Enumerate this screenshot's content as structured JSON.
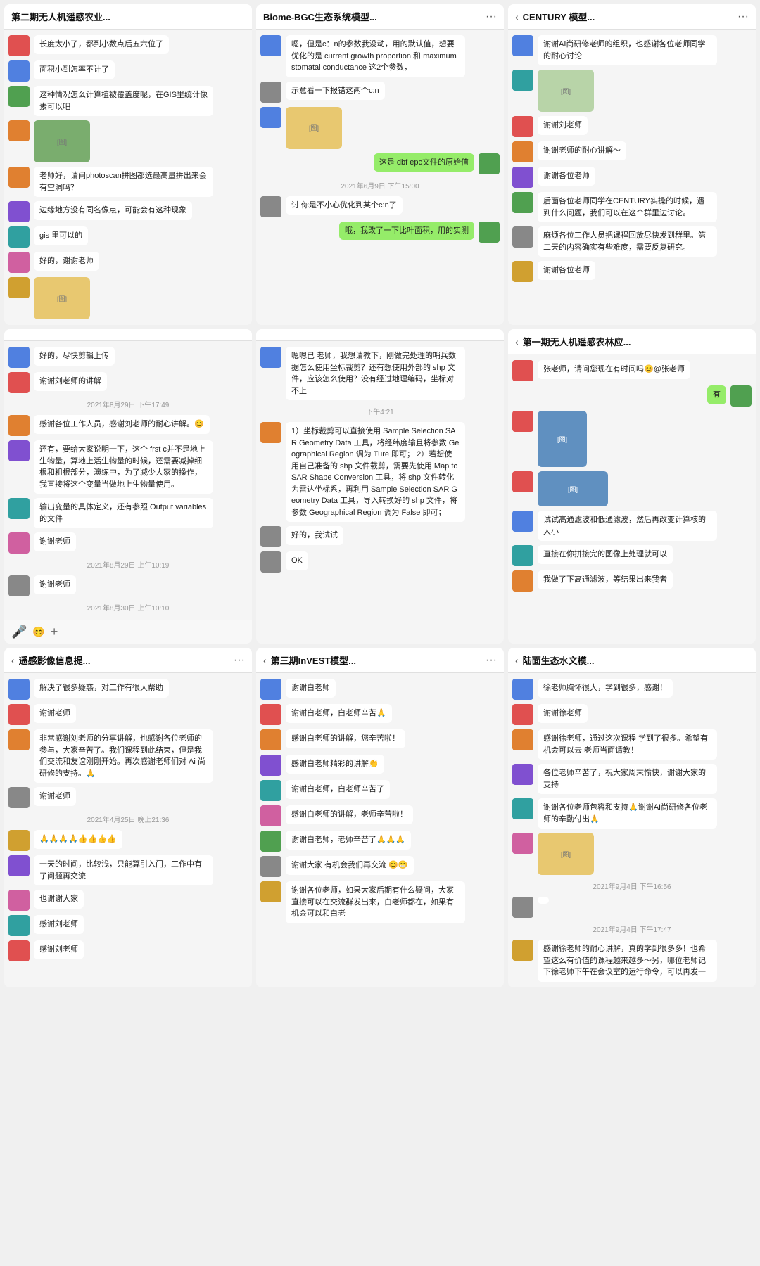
{
  "panels": [
    {
      "id": "panel-1",
      "hasBack": false,
      "title": "第二期无人机遥感农业...",
      "hasMore": false,
      "messages": [
        {
          "type": "msg",
          "side": "left",
          "avatarColor": "red",
          "text": "长度太小了，都到小数点后五六位了"
        },
        {
          "type": "msg",
          "side": "left",
          "avatarColor": "blue",
          "text": "面积小到怎率不计了"
        },
        {
          "type": "msg",
          "side": "left",
          "avatarColor": "green",
          "text": "这种情况怎么计算植被覆盖度呢，在GIS里统计像素可以吧"
        },
        {
          "type": "img",
          "side": "left",
          "avatarColor": "orange",
          "imgClass": "green-img"
        },
        {
          "type": "msg",
          "side": "left",
          "avatarColor": "orange",
          "text": "老师好，请问photoscan拼图都选最高量拼出来会有空洞吗？"
        },
        {
          "type": "msg",
          "side": "left",
          "avatarColor": "purple",
          "text": "边缘地方没有同名像点，可能会有这种现象"
        },
        {
          "type": "msg",
          "side": "left",
          "avatarColor": "teal",
          "text": "gis 里可以的"
        },
        {
          "type": "msg",
          "side": "left",
          "avatarColor": "pink",
          "text": "好的，谢谢老师"
        },
        {
          "type": "img",
          "side": "left",
          "avatarColor": "yellow",
          "imgClass": ""
        }
      ],
      "hasFooter": false
    },
    {
      "id": "panel-2",
      "hasBack": false,
      "title": "Biome-BGC生态系统模型...",
      "hasMore": true,
      "messages": [
        {
          "type": "msg",
          "side": "left",
          "avatarColor": "blue",
          "text": "嗯，但是c：n的参数我没动，用的默认值，想要优化的是 current growth proportion 和 maximum stomatal conductance 这2个参数，"
        },
        {
          "type": "msg",
          "side": "left",
          "avatarColor": "gray",
          "text": "示意看一下报错这两个c:n"
        },
        {
          "type": "img",
          "side": "left",
          "avatarColor": "blue",
          "imgClass": "doc-img"
        },
        {
          "type": "msg",
          "side": "right",
          "avatarColor": "green",
          "text": "这是 dbf epc文件的原始值"
        },
        {
          "type": "timestamp",
          "text": "2021年6月9日 下午15:00"
        },
        {
          "type": "msg",
          "side": "left",
          "avatarColor": "gray",
          "text": "讨 你是不小心优化到某个c:n了"
        },
        {
          "type": "msg",
          "side": "right",
          "avatarColor": "green",
          "text": "哦，我改了一下比叶面积，用的实测"
        }
      ],
      "hasFooter": false
    },
    {
      "id": "panel-3",
      "hasBack": true,
      "title": "CENTURY 模型...",
      "hasMore": true,
      "messages": [
        {
          "type": "msg",
          "side": "left",
          "avatarColor": "blue",
          "text": "谢谢AI尚研修老师的组织，也感谢各位老师同学的耐心讨论"
        },
        {
          "type": "img",
          "side": "left",
          "avatarColor": "teal",
          "imgClass": "map-img"
        },
        {
          "type": "msg",
          "side": "left",
          "avatarColor": "red",
          "text": "谢谢刘老师"
        },
        {
          "type": "msg",
          "side": "left",
          "avatarColor": "orange",
          "text": "谢谢老师的耐心讲解～"
        },
        {
          "type": "msg",
          "side": "left",
          "avatarColor": "purple",
          "text": "谢谢各位老师"
        },
        {
          "type": "msg",
          "side": "left",
          "avatarColor": "green",
          "text": "后面各位老师同学在CENTURY实操的时候，遇到什么问题，我们可以在这个群里边讨论。"
        },
        {
          "type": "msg",
          "side": "left",
          "avatarColor": "gray",
          "text": "麻烦各位工作人员把课程回放尽快发到群里。第二天的内容确实有些难度，需要反复研究。"
        },
        {
          "type": "msg",
          "side": "left",
          "avatarColor": "yellow",
          "text": "谢谢各位老师"
        }
      ],
      "hasFooter": false
    },
    {
      "id": "panel-4",
      "hasBack": false,
      "title": "",
      "hasMore": false,
      "messages": [
        {
          "type": "msg",
          "side": "left",
          "avatarColor": "blue",
          "text": "好的，尽快剪辑上传"
        },
        {
          "type": "msg",
          "side": "left",
          "avatarColor": "red",
          "text": "谢谢刘老师的讲解"
        },
        {
          "type": "timestamp",
          "text": "2021年8月29日 下午17:49"
        },
        {
          "type": "msg",
          "side": "left",
          "avatarColor": "orange",
          "text": "感谢各位工作人员，感谢刘老师的耐心讲解。😊"
        },
        {
          "type": "msg",
          "side": "left",
          "avatarColor": "purple",
          "text": "还有，要给大家说明一下，这个 frst c并不是地上生物量，算地上活生物量的时候，还需要减掉细根和粗根部分，演练中，为了减少大家的操作，我直接将这个变量当做地上生物量使用。"
        },
        {
          "type": "msg",
          "side": "left",
          "avatarColor": "teal",
          "text": "输出变量的具体定义，还有参照 Output variables 的文件"
        },
        {
          "type": "msg",
          "side": "left",
          "avatarColor": "pink",
          "text": "谢谢老师"
        },
        {
          "type": "timestamp",
          "text": "2021年8月29日 上午10:19"
        },
        {
          "type": "msg",
          "side": "left",
          "avatarColor": "gray",
          "text": "谢谢老师"
        },
        {
          "type": "timestamp",
          "text": "2021年8月30日 上午10:10"
        }
      ],
      "hasFooter": true
    },
    {
      "id": "panel-5",
      "hasBack": false,
      "title": "",
      "hasMore": false,
      "messages": [
        {
          "type": "msg",
          "side": "left",
          "avatarColor": "blue",
          "text": "嗯嗯已 老师，我想请教下，刚做完处理的哨兵数据怎么使用坐标裁剪？还有想使用外部的 shp 文件，应该怎么使用？没有经过地理编码，坐标对不上"
        },
        {
          "type": "timestamp",
          "text": "下午4:21"
        },
        {
          "type": "msg",
          "side": "left",
          "avatarColor": "orange",
          "text": "1）坐标裁剪可以直接使用 Sample Selection SAR Geometry Data 工具，将经纬度输且将参数 Geographical Region 调为 Ture 即可；\n2）若想使用自己准备的 shp 文件载剪，需要先使用 Map to SAR Shape Conversion 工具，将 shp 文件转化为雷达坐标系，再利用 Sample Selection SAR Geometry Data 工具，导入转换好的 shp 文件，将参数 Geographical Region 调为 False 即可；"
        },
        {
          "type": "msg",
          "side": "left",
          "avatarColor": "gray",
          "text": "好的，我试试"
        },
        {
          "type": "msg",
          "side": "left",
          "avatarColor": "gray",
          "text": "OK"
        }
      ],
      "hasFooter": false
    },
    {
      "id": "panel-6",
      "hasBack": true,
      "title": "第一期无人机遥感农林应...",
      "hasMore": false,
      "messages": [
        {
          "type": "msg",
          "side": "left",
          "avatarColor": "red",
          "text": "张老师，请问您现在有时间吗😊@张老师"
        },
        {
          "type": "msg",
          "side": "right",
          "avatarColor": "green",
          "text": "有"
        },
        {
          "type": "img",
          "side": "left",
          "avatarColor": "red",
          "imgClass": "screen-img tall"
        },
        {
          "type": "img",
          "side": "left",
          "avatarColor": "red",
          "imgClass": "screen-img wide"
        },
        {
          "type": "msg",
          "side": "left",
          "avatarColor": "blue",
          "text": "试试高通滤波和低通滤波，然后再改变计算核的大小"
        },
        {
          "type": "msg",
          "side": "left",
          "avatarColor": "teal",
          "text": "直接在你拼接完的图像上处理就可以"
        },
        {
          "type": "msg",
          "side": "left",
          "avatarColor": "orange",
          "text": "我做了下高通滤波，等结果出来我者"
        }
      ],
      "hasFooter": false
    },
    {
      "id": "panel-7",
      "hasBack": true,
      "title": "遥感影像信息提...",
      "hasMore": true,
      "messages": [
        {
          "type": "msg",
          "side": "left",
          "avatarColor": "blue",
          "text": "解决了很多疑惑，对工作有很大帮助"
        },
        {
          "type": "msg",
          "side": "left",
          "avatarColor": "red",
          "text": "谢谢老师"
        },
        {
          "type": "msg",
          "side": "left",
          "avatarColor": "orange",
          "text": "非常感谢刘老师的分享讲解，也感谢各位老师的参与，大家辛苦了。我们课程到此结束，但是我们交流和友谊刚刚开始。再次感谢老师们对 Ai 尚研修的支持。🙏"
        },
        {
          "type": "msg",
          "side": "left",
          "avatarColor": "gray",
          "text": "谢谢老师"
        },
        {
          "type": "timestamp",
          "text": "2021年4月25日 晚上21:36"
        },
        {
          "type": "msg",
          "side": "left",
          "avatarColor": "yellow",
          "text": "🙏🙏🙏🙏👍👍👍👍"
        },
        {
          "type": "msg",
          "side": "left",
          "avatarColor": "purple",
          "text": "一天的时间，比较浅，只能算引入门，工作中有了问题再交流"
        },
        {
          "type": "msg",
          "side": "left",
          "avatarColor": "pink",
          "text": "也谢谢大家"
        },
        {
          "type": "msg",
          "side": "left",
          "avatarColor": "teal",
          "text": "感谢刘老师"
        },
        {
          "type": "msg",
          "side": "left",
          "avatarColor": "red",
          "text": "感谢刘老师"
        }
      ],
      "hasFooter": false
    },
    {
      "id": "panel-8",
      "hasBack": true,
      "title": "第三期InVEST模型...",
      "hasMore": true,
      "messages": [
        {
          "type": "msg",
          "side": "left",
          "avatarColor": "blue",
          "text": "谢谢白老师"
        },
        {
          "type": "msg",
          "side": "left",
          "avatarColor": "red",
          "text": "谢谢白老师，白老师辛苦🙏"
        },
        {
          "type": "msg",
          "side": "left",
          "avatarColor": "orange",
          "text": "感谢白老师的讲解，您辛苦啦！"
        },
        {
          "type": "msg",
          "side": "left",
          "avatarColor": "purple",
          "text": "感谢白老师精彩的讲解👏"
        },
        {
          "type": "msg",
          "side": "left",
          "avatarColor": "teal",
          "text": "谢谢白老师，白老师辛苦了"
        },
        {
          "type": "msg",
          "side": "left",
          "avatarColor": "pink",
          "text": "感谢白老师的讲解，老师辛苦啦！"
        },
        {
          "type": "msg",
          "side": "left",
          "avatarColor": "green",
          "text": "谢谢白老师，老师辛苦了🙏🙏🙏"
        },
        {
          "type": "msg",
          "side": "left",
          "avatarColor": "gray",
          "text": "谢谢大家 有机会我们再交流 😊😁"
        },
        {
          "type": "msg",
          "side": "left",
          "avatarColor": "yellow",
          "text": "谢谢各位老师，如果大家后期有什么疑问，大家直接可以在交流群发出来，白老师都在，如果有机会可以和白老"
        }
      ],
      "hasFooter": false
    },
    {
      "id": "panel-9",
      "hasBack": true,
      "title": "陆面生态水文模...",
      "hasMore": false,
      "messages": [
        {
          "type": "msg",
          "side": "left",
          "avatarColor": "blue",
          "text": "徐老师胸怀很大，学到很多，感谢！"
        },
        {
          "type": "msg",
          "side": "left",
          "avatarColor": "red",
          "text": "谢谢徐老师"
        },
        {
          "type": "msg",
          "side": "left",
          "avatarColor": "orange",
          "text": "感谢徐老师，通过这次课程 学到了很多。希望有机会可以去 老师当面请教！"
        },
        {
          "type": "msg",
          "side": "left",
          "avatarColor": "purple",
          "text": "各位老师辛苦了，祝大家周末愉快，谢谢大家的支持"
        },
        {
          "type": "msg",
          "side": "left",
          "avatarColor": "teal",
          "text": "谢谢各位老师包容和支持🙏谢谢AI尚研修各位老师的辛勤付出🙏"
        },
        {
          "type": "img",
          "side": "left",
          "avatarColor": "pink",
          "imgClass": ""
        },
        {
          "type": "timestamp",
          "text": "2021年9月4日 下午16:56"
        },
        {
          "type": "msg",
          "side": "left",
          "avatarColor": "gray",
          "text": ""
        },
        {
          "type": "timestamp",
          "text": "2021年9月4日 下午17:47"
        },
        {
          "type": "msg",
          "side": "left",
          "avatarColor": "yellow",
          "text": "感谢徐老师的耐心讲解，真的学到很多多！也希望这么有价值的课程越来越多～另，哪位老师记下徐老师下午在会议室的运行命令，可以再发一"
        }
      ],
      "hasFooter": false
    }
  ],
  "footer": {
    "voiceIcon": "🎤",
    "emojiIcon": "😊",
    "plusIcon": "+"
  }
}
